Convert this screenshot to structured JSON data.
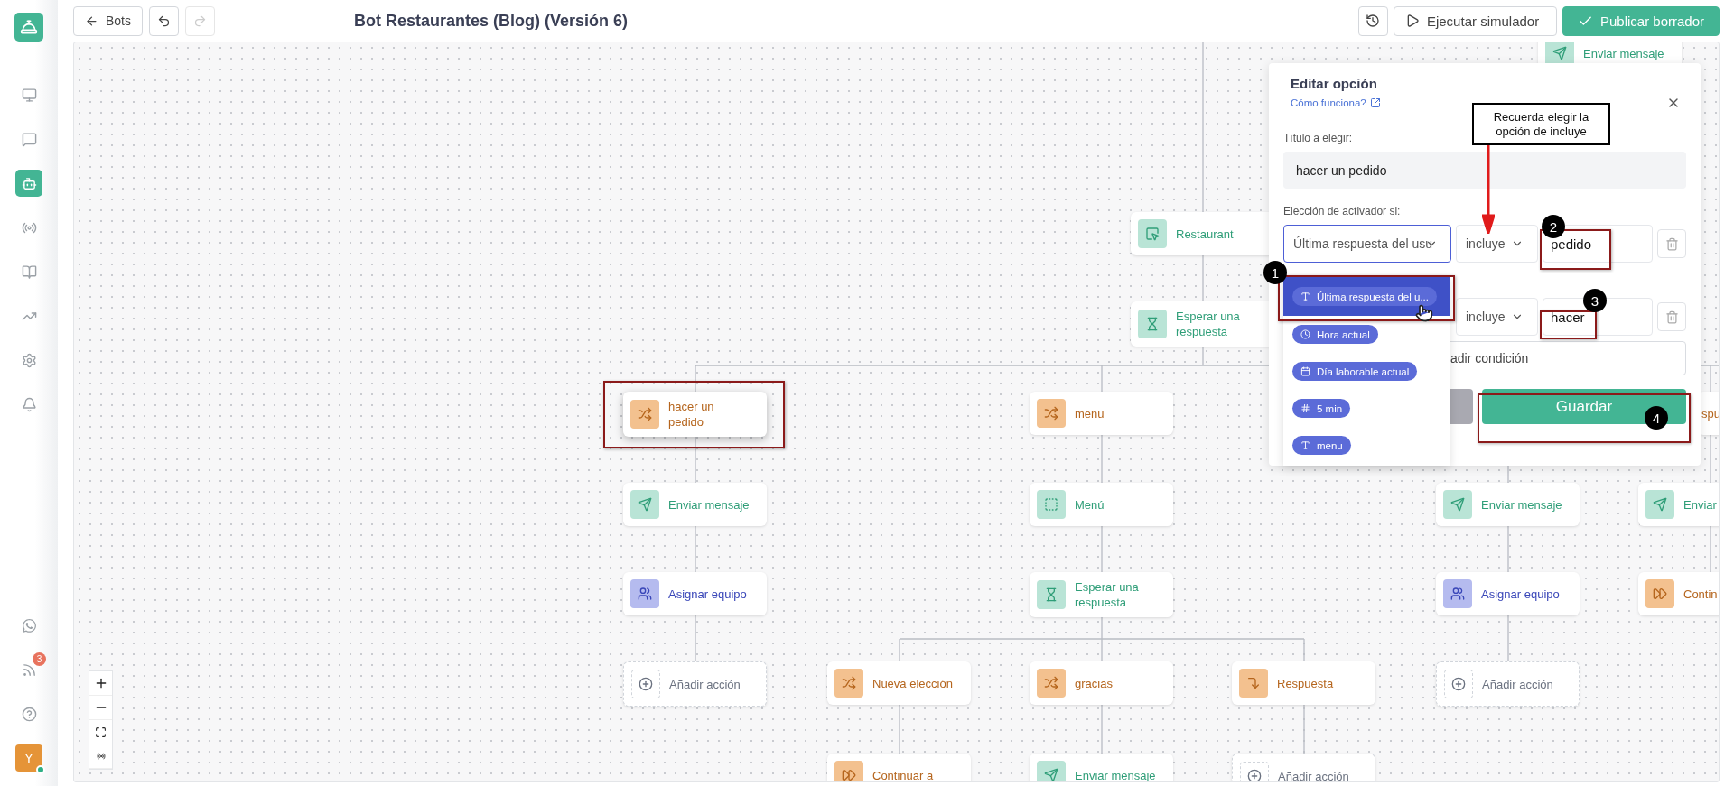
{
  "sidebar": {
    "items": [
      {
        "selected": false
      },
      {
        "selected": false
      },
      {
        "selected": true
      },
      {
        "selected": false
      },
      {
        "selected": false
      },
      {
        "selected": false
      },
      {
        "selected": false
      },
      {
        "selected": false
      }
    ],
    "bottom_items": [
      {
        "selected": false
      },
      {
        "selected": false,
        "badge": "3"
      },
      {
        "selected": false
      }
    ],
    "avatar": {
      "initial": "Y",
      "online": true
    }
  },
  "toolbar": {
    "back": "Bots",
    "undo": {
      "disabled": false
    },
    "redo": {
      "disabled": true
    },
    "title": "Bot Restaurantes (Blog) (Versión 6)",
    "simulate": "Ejecutar simulador",
    "publish": "Publicar borrador"
  },
  "canvas": {
    "nodes": [
      {
        "label": "Enviar mensaje",
        "kind": "message",
        "selected": false
      },
      {
        "label": "Restaurant",
        "kind": "trigger",
        "selected": false
      },
      {
        "label": "Esperar una respuesta",
        "kind": "wait",
        "selected": false
      },
      {
        "label": "hacer un pedido",
        "kind": "choice",
        "selected": true
      },
      {
        "label": "menu",
        "kind": "choice",
        "selected": false
      },
      {
        "label": "spu",
        "kind": "clipped",
        "selected": false
      },
      {
        "label": "Enviar mensaje",
        "kind": "message",
        "selected": false
      },
      {
        "label": "Menú",
        "kind": "menu",
        "selected": false
      },
      {
        "label": "Enviar mensaje",
        "kind": "message",
        "selected": false
      },
      {
        "label": "Enviar",
        "kind": "message",
        "selected": false
      },
      {
        "label": "Asignar equipo",
        "kind": "team",
        "selected": false
      },
      {
        "label": "Esperar una respuesta",
        "kind": "wait",
        "selected": false
      },
      {
        "label": "Asignar equipo",
        "kind": "team",
        "selected": false
      },
      {
        "label": "Contin",
        "kind": "continue",
        "selected": false
      },
      {
        "label": "Añadir acción",
        "kind": "add",
        "selected": false
      },
      {
        "label": "Nueva elección",
        "kind": "choice",
        "selected": false
      },
      {
        "label": "gracias",
        "kind": "choice",
        "selected": false
      },
      {
        "label": "Respuesta",
        "kind": "reply",
        "selected": false
      },
      {
        "label": "Añadir acción",
        "kind": "add",
        "selected": false
      },
      {
        "label": "Continuar a",
        "kind": "continue",
        "selected": false
      },
      {
        "label": "Enviar mensaje",
        "kind": "message",
        "selected": false
      },
      {
        "label": "Añadir acción",
        "kind": "add",
        "selected": false
      }
    ]
  },
  "panel": {
    "title": "Editar opción",
    "help_link": "Cómo funciona?",
    "title_label": "Título a elegir:",
    "title_value": "hacer un pedido",
    "conditions_label": "Elección de activador si:",
    "conditions": [
      {
        "field": "Última respuesta del usu",
        "focused": true,
        "operator": "incluye",
        "value": "pedido"
      },
      {
        "operator": "incluye",
        "value": "hacer"
      }
    ],
    "add_condition": "adir condición",
    "save": "Guardar"
  },
  "dropdown": {
    "options": [
      {
        "label": "Última respuesta del u...",
        "kind": "text",
        "selected": true
      },
      {
        "label": "Hora actual",
        "kind": "time",
        "selected": false
      },
      {
        "label": "Día laborable actual",
        "kind": "date",
        "selected": false
      },
      {
        "label": "5 min",
        "kind": "number",
        "selected": false
      },
      {
        "label": "menu",
        "kind": "text",
        "selected": false
      }
    ]
  },
  "annotations": {
    "callout": "Recuerda elegir la opción de incluye",
    "markers": [
      "1",
      "2",
      "3",
      "4"
    ]
  }
}
